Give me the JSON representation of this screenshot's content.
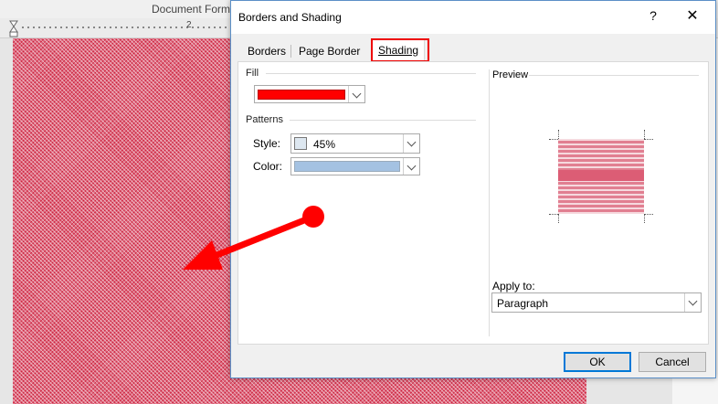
{
  "word": {
    "title": "Document Forma",
    "ruler_mark": "2"
  },
  "dialog": {
    "title": "Borders and Shading",
    "help": "?",
    "close": "✕",
    "tabs": [
      {
        "label": "Borders"
      },
      {
        "label": "Page Border"
      },
      {
        "label": "Shading"
      }
    ],
    "active_tab": "Shading",
    "fill": {
      "label": "Fill",
      "color": "#ff0000"
    },
    "patterns": {
      "label": "Patterns",
      "style_label": "Style:",
      "style_value": "45%",
      "color_label": "Color:",
      "color_value": "#a4c2e2"
    },
    "preview": {
      "label": "Preview"
    },
    "apply_to": {
      "label": "Apply to:",
      "value": "Paragraph"
    },
    "buttons": {
      "ok": "OK",
      "cancel": "Cancel"
    }
  },
  "annotation": {
    "arrow_color": "#ff0000",
    "highlight_color": "#e00000"
  }
}
